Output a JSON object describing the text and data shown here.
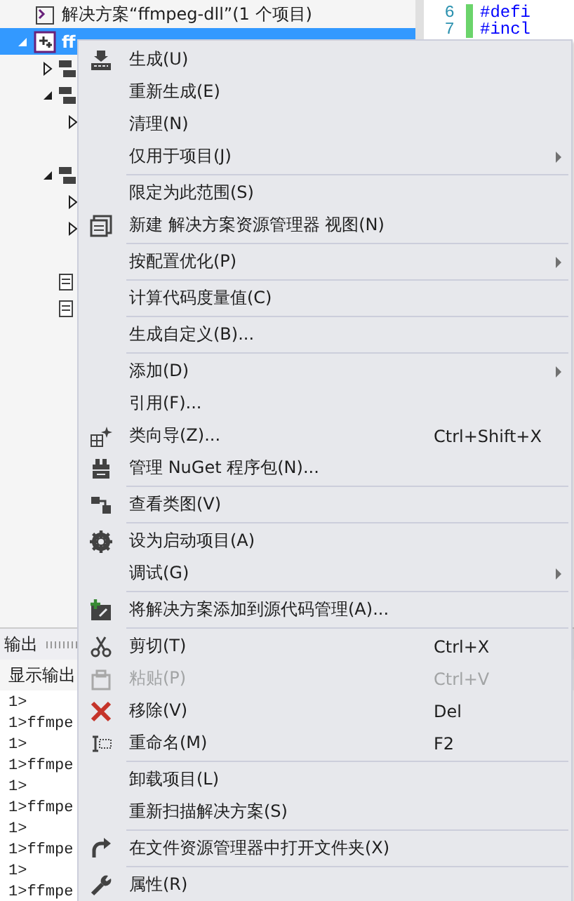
{
  "solution_explorer": {
    "rows": [
      {
        "label": "解决方案“ffmpeg-dll”(1 个项目)",
        "kind": "solution",
        "selected": false,
        "expanded": null
      },
      {
        "label": "ff",
        "kind": "project",
        "selected": true,
        "expanded": true
      },
      {
        "kind": "folder",
        "selected": false,
        "expanded": false
      },
      {
        "kind": "folder",
        "selected": false,
        "expanded": true
      },
      {
        "selected": false,
        "expanded": false
      },
      {
        "kind": "blank",
        "selected": false,
        "expanded": null
      },
      {
        "kind": "folder",
        "selected": false,
        "expanded": true
      },
      {
        "selected": false,
        "expanded": false
      },
      {
        "selected": false,
        "expanded": false
      },
      {
        "kind": "blank",
        "selected": false,
        "expanded": null
      },
      {
        "kind": "file",
        "selected": false,
        "expanded": null
      },
      {
        "kind": "file",
        "selected": false,
        "expanded": null
      }
    ]
  },
  "editor": {
    "lines": [
      {
        "number": "6",
        "code": "#defi"
      },
      {
        "number": "7",
        "code": "#incl"
      }
    ]
  },
  "output": {
    "title": "输出",
    "show_label": "显示输出",
    "lines": [
      "1>",
      "1>ffmpe",
      "1>",
      "1>ffmpe",
      "1>",
      "1>ffmpe",
      "1>",
      "1>ffmpe",
      "1>",
      "1>ffmpe"
    ]
  },
  "context_menu": {
    "items": [
      {
        "kind": "item",
        "label": "生成(U)",
        "submenu": false,
        "disabled": false
      },
      {
        "kind": "item",
        "label": "重新生成(E)",
        "submenu": false,
        "disabled": false
      },
      {
        "kind": "item",
        "label": "清理(N)",
        "submenu": false,
        "disabled": false
      },
      {
        "kind": "item",
        "label": "仅用于项目(J)",
        "submenu": true,
        "disabled": false
      },
      {
        "kind": "separator"
      },
      {
        "kind": "item",
        "label": "限定为此范围(S)",
        "submenu": false,
        "disabled": false
      },
      {
        "kind": "item",
        "label": "新建 解决方案资源管理器 视图(N)",
        "submenu": false,
        "disabled": false
      },
      {
        "kind": "separator"
      },
      {
        "kind": "item",
        "label": "按配置优化(P)",
        "submenu": true,
        "disabled": false
      },
      {
        "kind": "separator"
      },
      {
        "kind": "item",
        "label": "计算代码度量值(C)",
        "submenu": false,
        "disabled": false
      },
      {
        "kind": "separator"
      },
      {
        "kind": "item",
        "label": "生成自定义(B)...",
        "submenu": false,
        "disabled": false
      },
      {
        "kind": "separator"
      },
      {
        "kind": "item",
        "label": "添加(D)",
        "submenu": true,
        "disabled": false
      },
      {
        "kind": "item",
        "label": "引用(F)...",
        "submenu": false,
        "disabled": false
      },
      {
        "kind": "item",
        "label": "类向导(Z)...",
        "shortcut": "Ctrl+Shift+X",
        "submenu": false,
        "disabled": false
      },
      {
        "kind": "item",
        "label": "管理 NuGet 程序包(N)...",
        "submenu": false,
        "disabled": false
      },
      {
        "kind": "separator"
      },
      {
        "kind": "item",
        "label": "查看类图(V)",
        "submenu": false,
        "disabled": false
      },
      {
        "kind": "separator"
      },
      {
        "kind": "item",
        "label": "设为启动项目(A)",
        "submenu": false,
        "disabled": false
      },
      {
        "kind": "item",
        "label": "调试(G)",
        "submenu": true,
        "disabled": false
      },
      {
        "kind": "separator"
      },
      {
        "kind": "item",
        "label": "将解决方案添加到源代码管理(A)...",
        "submenu": false,
        "disabled": false
      },
      {
        "kind": "separator"
      },
      {
        "kind": "item",
        "label": "剪切(T)",
        "shortcut": "Ctrl+X",
        "submenu": false,
        "disabled": false
      },
      {
        "kind": "item",
        "label": "粘贴(P)",
        "shortcut": "Ctrl+V",
        "submenu": false,
        "disabled": true
      },
      {
        "kind": "item",
        "label": "移除(V)",
        "shortcut": "Del",
        "submenu": false,
        "disabled": false
      },
      {
        "kind": "item",
        "label": "重命名(M)",
        "shortcut": "F2",
        "submenu": false,
        "disabled": false
      },
      {
        "kind": "separator"
      },
      {
        "kind": "item",
        "label": "卸载项目(L)",
        "submenu": false,
        "disabled": false
      },
      {
        "kind": "item",
        "label": "重新扫描解决方案(S)",
        "submenu": false,
        "disabled": false
      },
      {
        "kind": "separator"
      },
      {
        "kind": "item",
        "label": "在文件资源管理器中打开文件夹(X)",
        "submenu": false,
        "disabled": false
      },
      {
        "kind": "separator"
      },
      {
        "kind": "item",
        "label": "属性(R)",
        "submenu": false,
        "disabled": false
      }
    ]
  }
}
